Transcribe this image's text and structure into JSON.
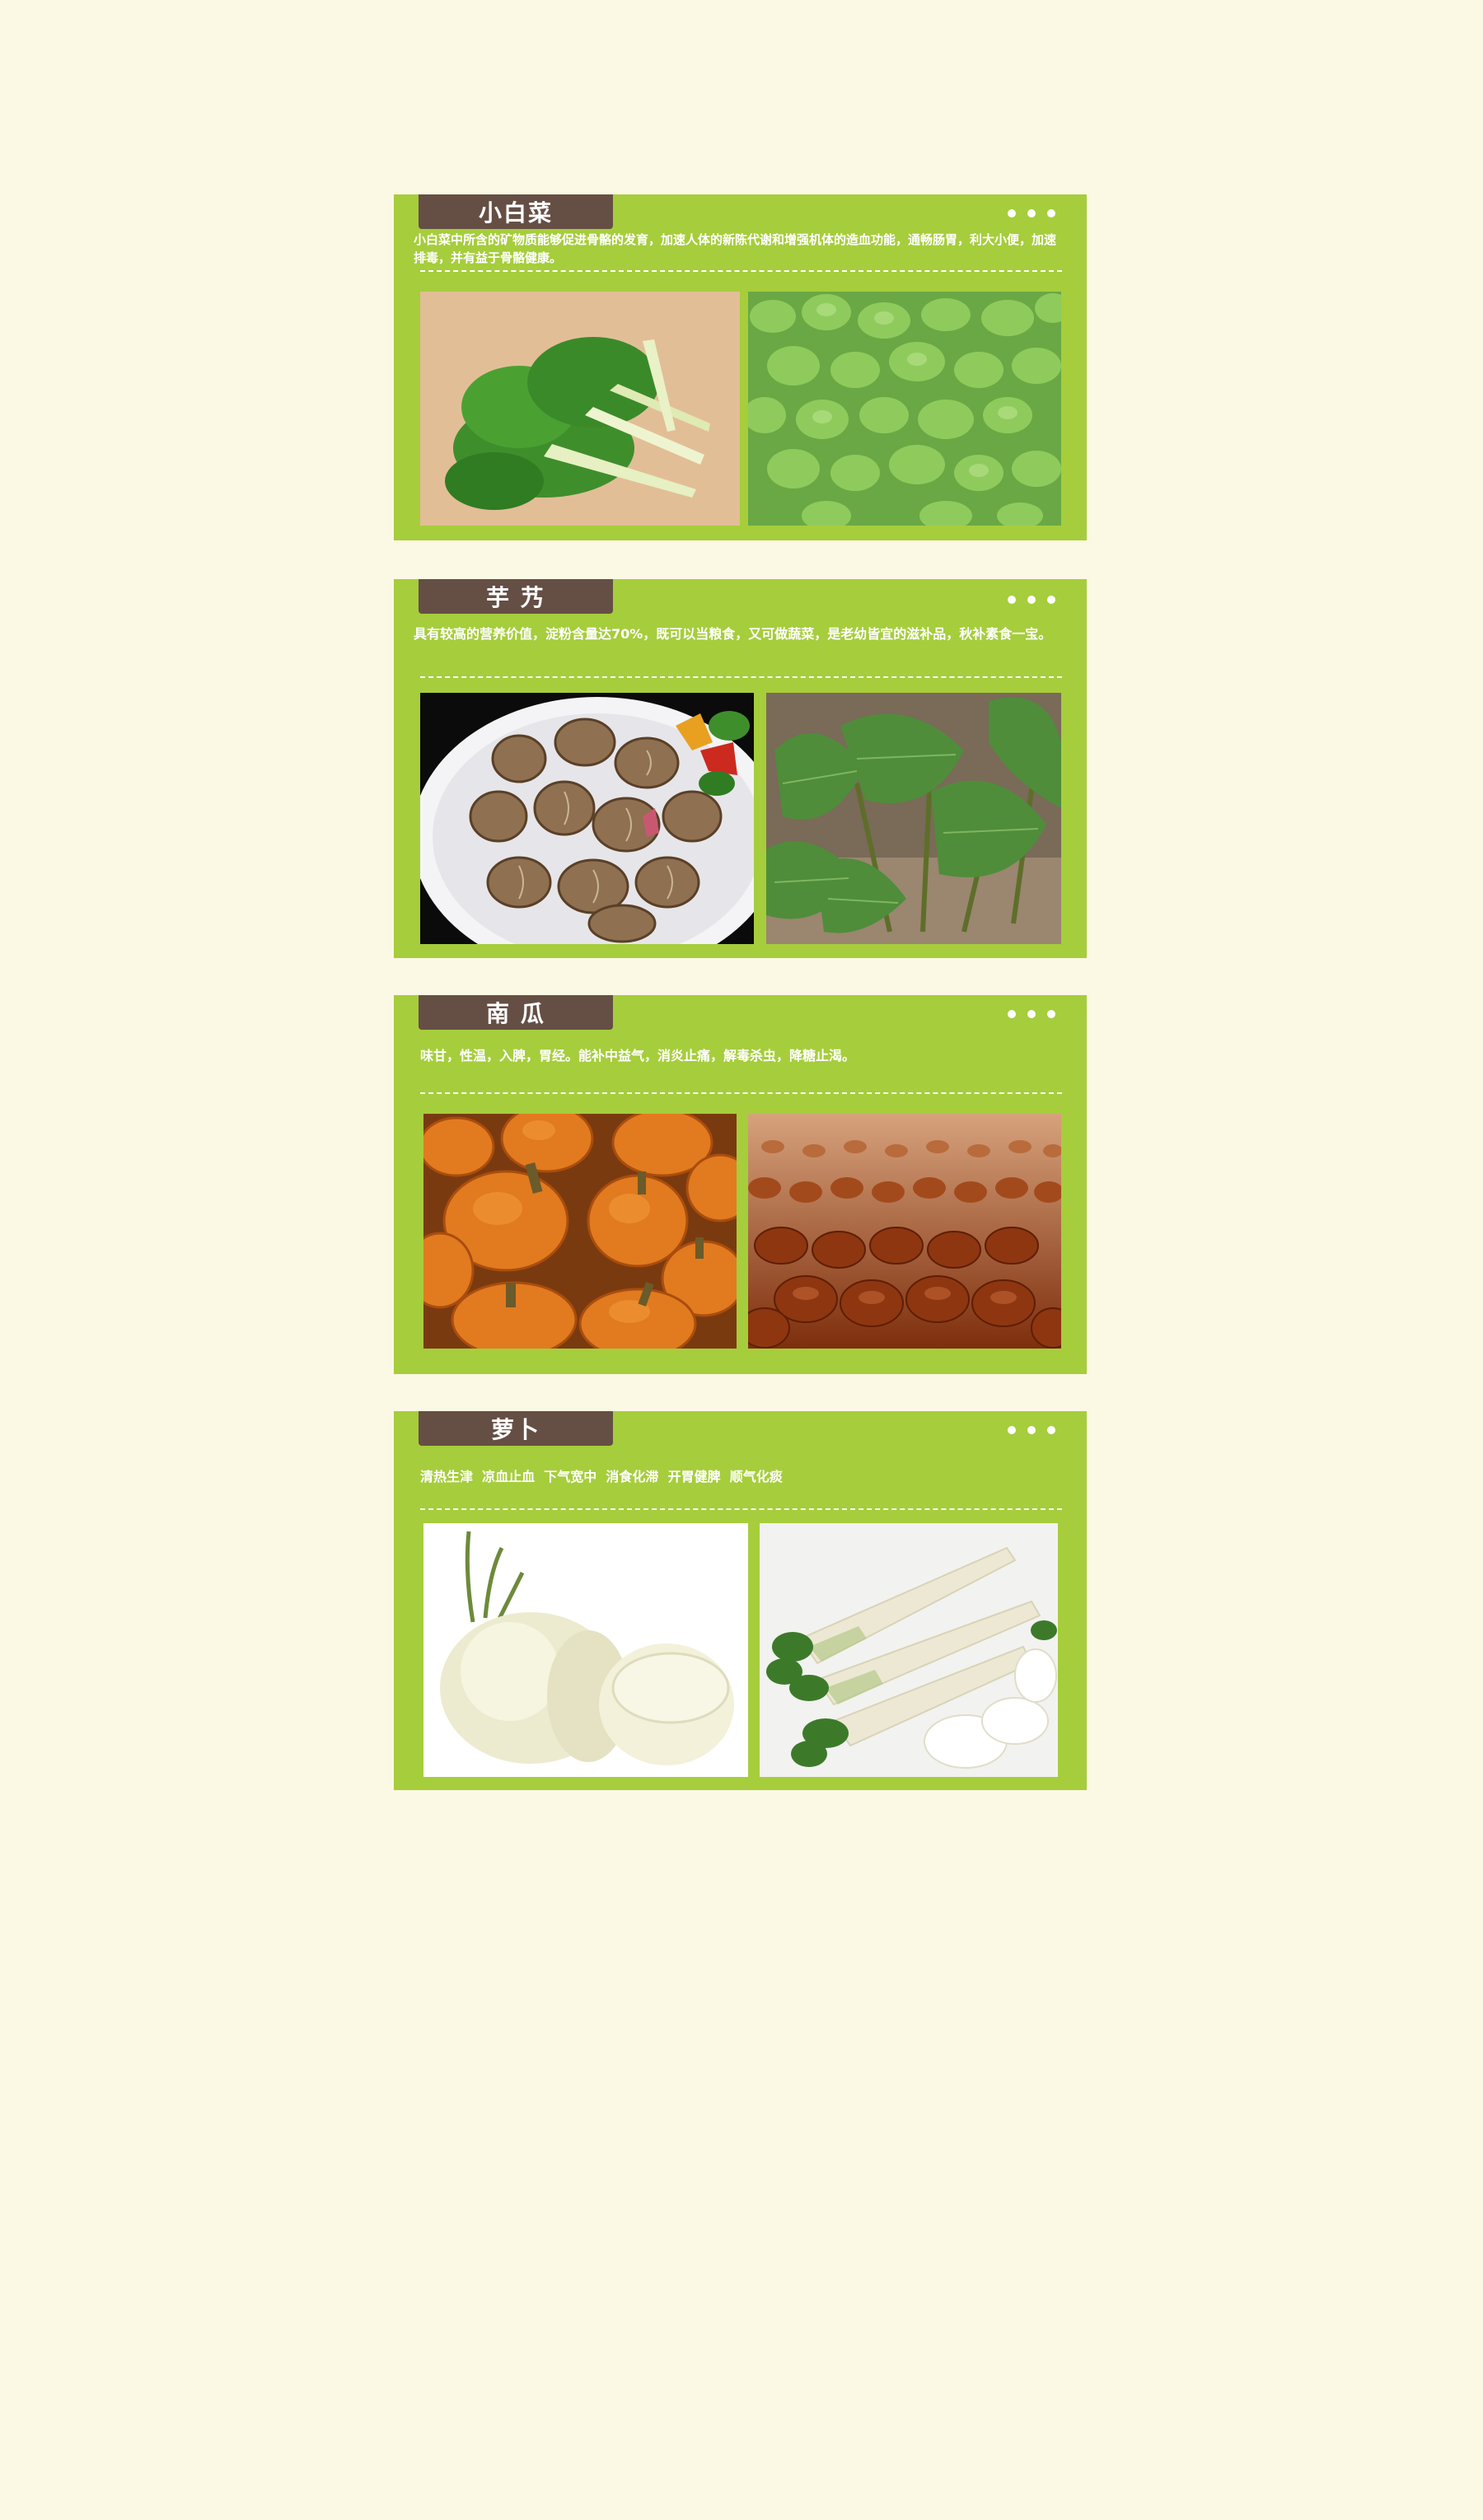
{
  "sections": [
    {
      "title": "小白菜",
      "desc": "小白菜中所含的矿物质能够促进骨骼的发育，加速人体的新陈代谢和增强机体的造血功能，通畅肠胃，利大小便，加速排毒，并有益于骨骼健康。"
    },
    {
      "title": "芋 艿",
      "desc": "具有较高的营养价值，淀粉含量达70%，既可以当粮食，又可做蔬菜，是老幼皆宜的滋补品，秋补素食一宝。"
    },
    {
      "title": "南 瓜",
      "desc": "味甘，性温，入脾，胃经。能补中益气，消炎止痛，解毒杀虫，降糖止渴。"
    },
    {
      "title": "萝卜",
      "desc": "清热生津  凉血止血  下气宽中  消食化滞  开胃健脾  顺气化痰"
    }
  ],
  "colors": {
    "page_bg": "#fbf8e4",
    "card_green": "#a6cd3c",
    "tab_brown": "#654f45"
  }
}
